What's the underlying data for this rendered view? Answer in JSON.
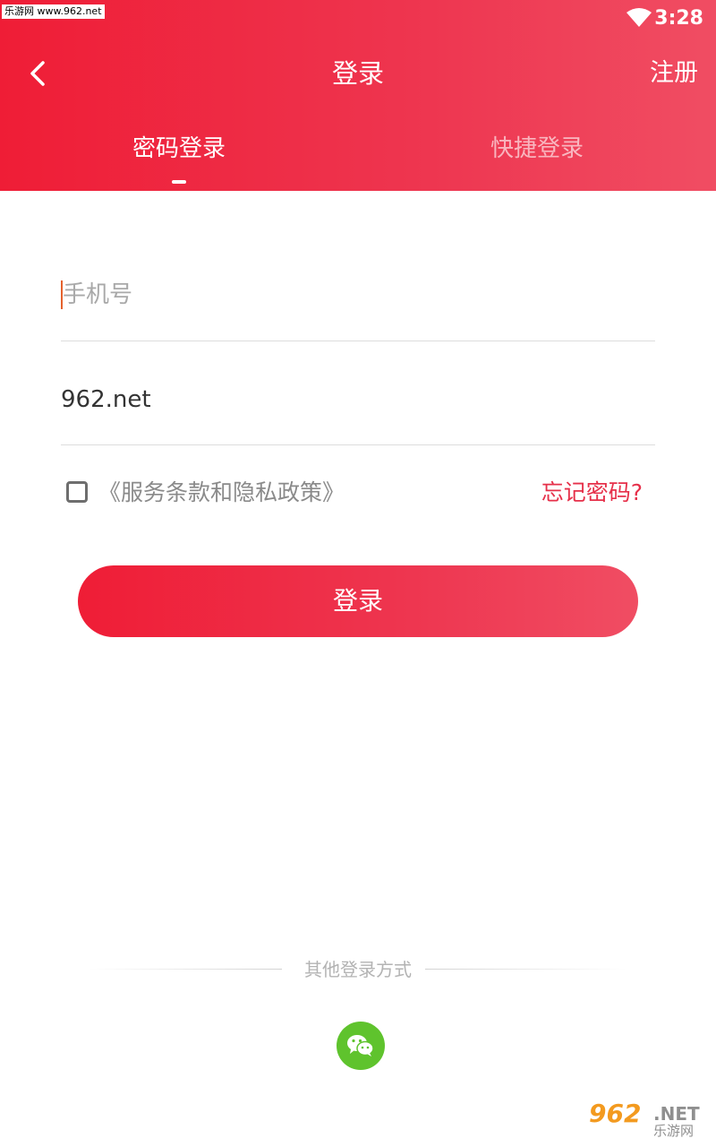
{
  "status_bar": {
    "time": "3:28",
    "watermark": "乐游网 www.962.net"
  },
  "header": {
    "title": "登录",
    "right_action": "注册",
    "back_icon": "chevron-left-icon"
  },
  "tabs": [
    {
      "label": "密码登录",
      "active": true
    },
    {
      "label": "快捷登录",
      "active": false
    }
  ],
  "form": {
    "phone_placeholder": "手机号",
    "password_value": "962.net",
    "terms_label": "《服务条款和隐私政策》",
    "terms_checked": false,
    "forgot_label": "忘记密码?",
    "submit_label": "登录"
  },
  "other_login": {
    "label": "其他登录方式",
    "methods": [
      {
        "icon": "wechat-icon"
      }
    ]
  },
  "watermark_bottom": {
    "number": "962",
    "suffix": ".NET",
    "cn": "乐游网"
  },
  "colors": {
    "brand_red": "#ef1d36",
    "brand_red_light": "#f04d63",
    "accent_text": "#e6304a",
    "wechat_green": "#5fc32d"
  }
}
